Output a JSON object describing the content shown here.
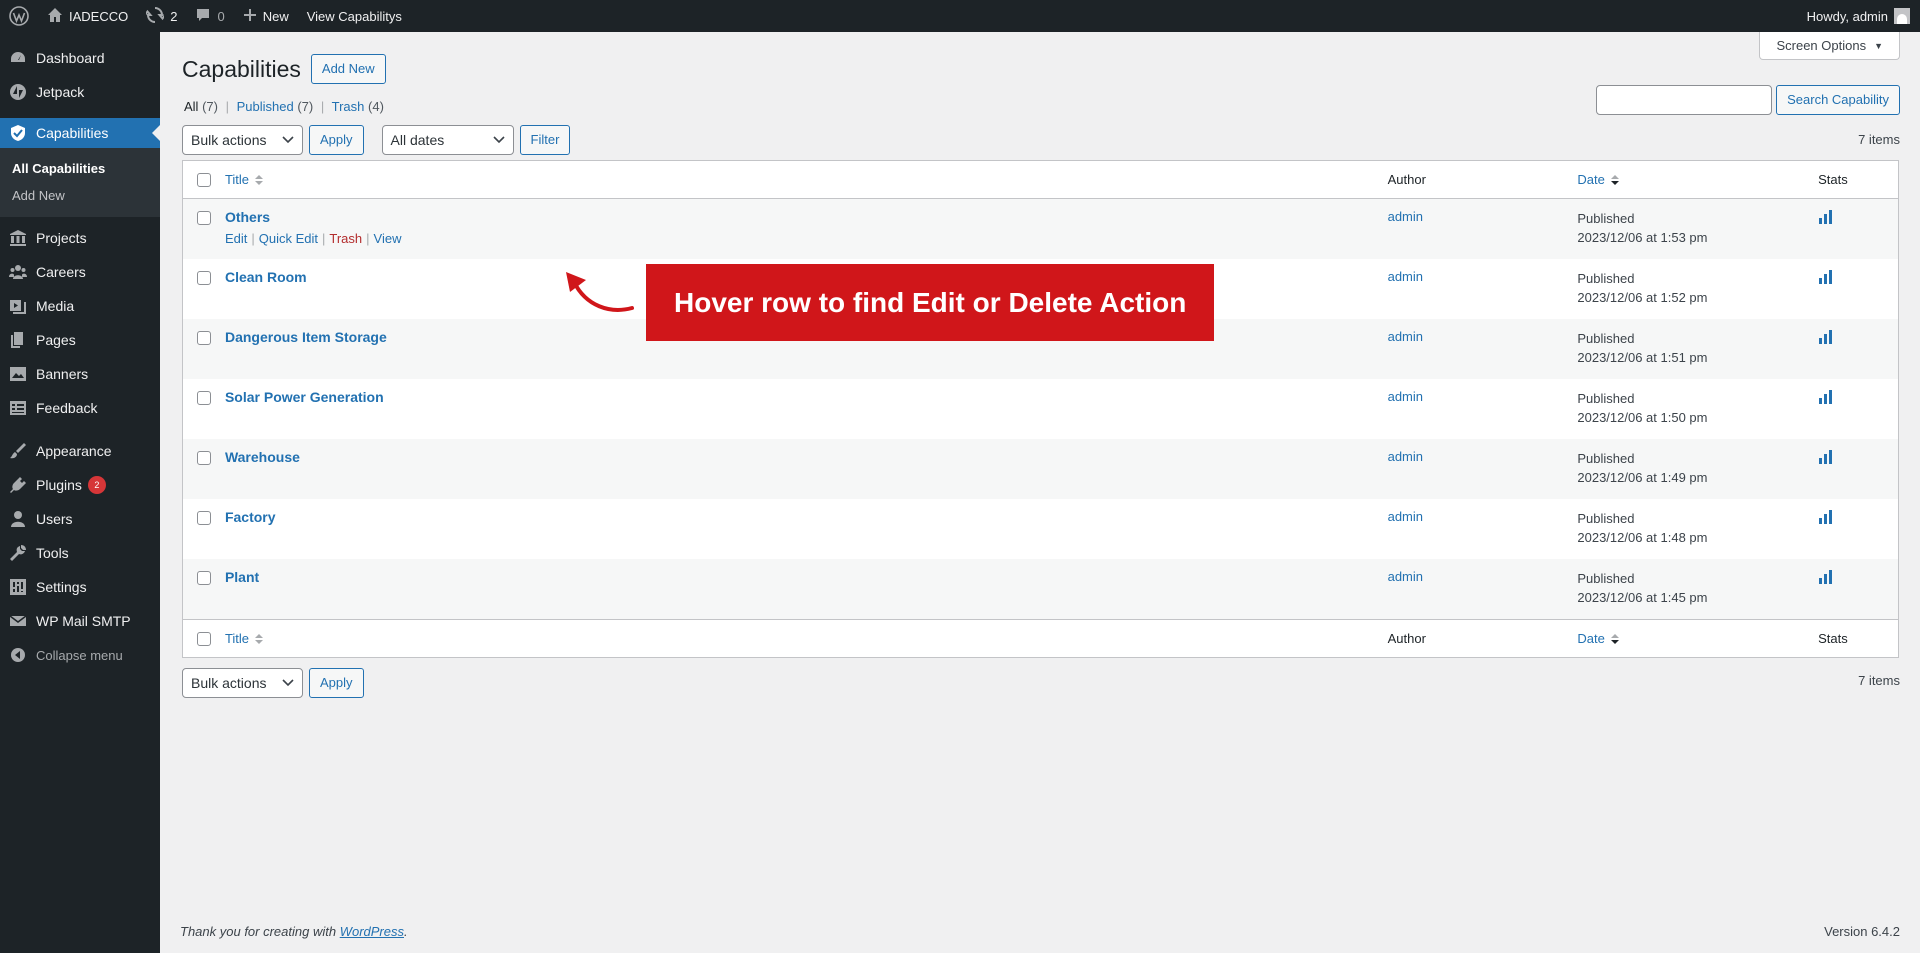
{
  "adminbar": {
    "site_name": "IADECCO",
    "updates_count": "2",
    "comments_count": "0",
    "new_label": "New",
    "view_label": "View Capabilitys",
    "howdy": "Howdy, admin"
  },
  "sidebar": {
    "dashboard": "Dashboard",
    "jetpack": "Jetpack",
    "capabilities": "Capabilities",
    "all_capabilities": "All Capabilities",
    "add_new": "Add New",
    "projects": "Projects",
    "careers": "Careers",
    "media": "Media",
    "pages": "Pages",
    "banners": "Banners",
    "feedback": "Feedback",
    "appearance": "Appearance",
    "plugins": "Plugins",
    "plugins_badge": "2",
    "users": "Users",
    "tools": "Tools",
    "settings": "Settings",
    "wp_mail_smtp": "WP Mail SMTP",
    "collapse": "Collapse menu"
  },
  "header": {
    "screen_options": "Screen Options",
    "page_title": "Capabilities",
    "add_new": "Add New"
  },
  "views": {
    "all": "All",
    "all_count": "(7)",
    "published": "Published",
    "published_count": "(7)",
    "trash": "Trash",
    "trash_count": "(4)"
  },
  "search": {
    "value": "",
    "button": "Search Capability"
  },
  "tablenav": {
    "bulk_actions": "Bulk actions",
    "apply": "Apply",
    "all_dates": "All dates",
    "filter": "Filter",
    "items_count": "7 items"
  },
  "table": {
    "columns": {
      "title": "Title",
      "author": "Author",
      "date": "Date",
      "stats": "Stats"
    },
    "row_actions": {
      "edit": "Edit",
      "quick_edit": "Quick Edit",
      "trash": "Trash",
      "view": "View"
    },
    "rows": [
      {
        "title": "Others",
        "author": "admin",
        "status": "Published",
        "date": "2023/12/06 at 1:53 pm"
      },
      {
        "title": "Clean Room",
        "author": "admin",
        "status": "Published",
        "date": "2023/12/06 at 1:52 pm"
      },
      {
        "title": "Dangerous Item Storage",
        "author": "admin",
        "status": "Published",
        "date": "2023/12/06 at 1:51 pm"
      },
      {
        "title": "Solar Power Generation",
        "author": "admin",
        "status": "Published",
        "date": "2023/12/06 at 1:50 pm"
      },
      {
        "title": "Warehouse",
        "author": "admin",
        "status": "Published",
        "date": "2023/12/06 at 1:49 pm"
      },
      {
        "title": "Factory",
        "author": "admin",
        "status": "Published",
        "date": "2023/12/06 at 1:48 pm"
      },
      {
        "title": "Plant",
        "author": "admin",
        "status": "Published",
        "date": "2023/12/06 at 1:45 pm"
      }
    ]
  },
  "annotation": {
    "text": "Hover row to find Edit or Delete Action"
  },
  "footer": {
    "thanks_prefix": "Thank you for creating with ",
    "wordpress_link": "WordPress",
    "thanks_suffix": ".",
    "version": "Version 6.4.2"
  },
  "colors": {
    "admin_bar": "#1d2327",
    "accent": "#2271b1",
    "callout": "#d0161a",
    "trash": "#b32d2e"
  }
}
